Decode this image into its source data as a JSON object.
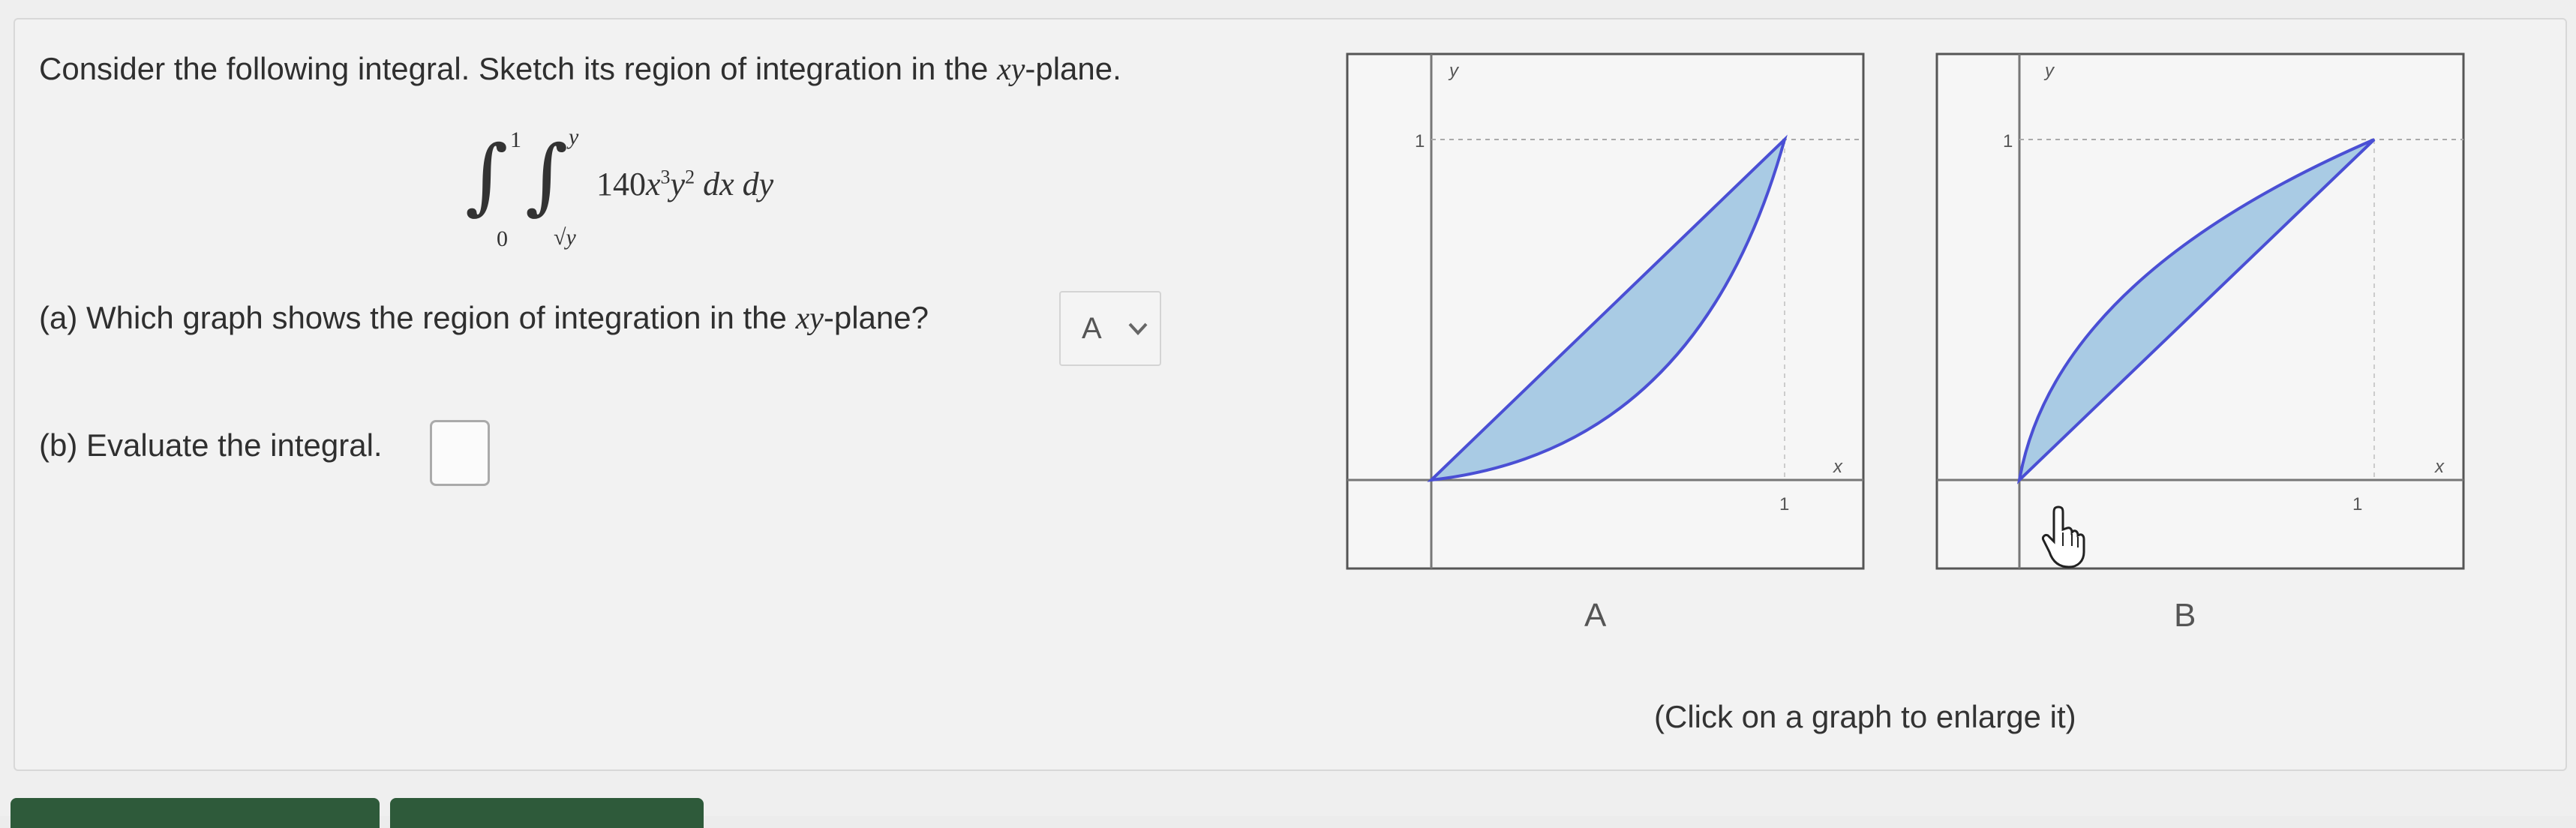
{
  "question": {
    "prompt_before": "Consider the following integral. Sketch its region of integration in the ",
    "prompt_var": "xy",
    "prompt_after": "-plane."
  },
  "integral": {
    "outer_upper": "1",
    "outer_lower": "0",
    "inner_upper": "y",
    "inner_lower": "√y",
    "coef": "140",
    "x_var": "x",
    "x_exp": "3",
    "y_var": "y",
    "y_exp": "2",
    "dx": "dx",
    "dy": "dy"
  },
  "part_a": {
    "label_before": "(a) Which graph shows the region of integration in the ",
    "label_var": "xy",
    "label_after": "-plane?",
    "selected": "A"
  },
  "part_b": {
    "label": "(b) Evaluate the integral."
  },
  "graphs": [
    {
      "caption": "A",
      "y_axis_label": "y",
      "x_axis_label": "x",
      "y_tick": "1",
      "x_tick": "1",
      "region_fill": "#a9cbe4",
      "region_stroke": "#4a4fd4"
    },
    {
      "caption": "B",
      "y_axis_label": "y",
      "x_axis_label": "x",
      "y_tick": "1",
      "x_tick": "1",
      "region_fill": "#a9cbe4",
      "region_stroke": "#4a4fd4"
    }
  ],
  "hint": "(Click on a graph to enlarge it)",
  "colors": {
    "accent_button": "#2e5a3a"
  },
  "icons": {
    "cursor": "hand-pointer-icon",
    "dropdown": "chevron-down-icon"
  }
}
